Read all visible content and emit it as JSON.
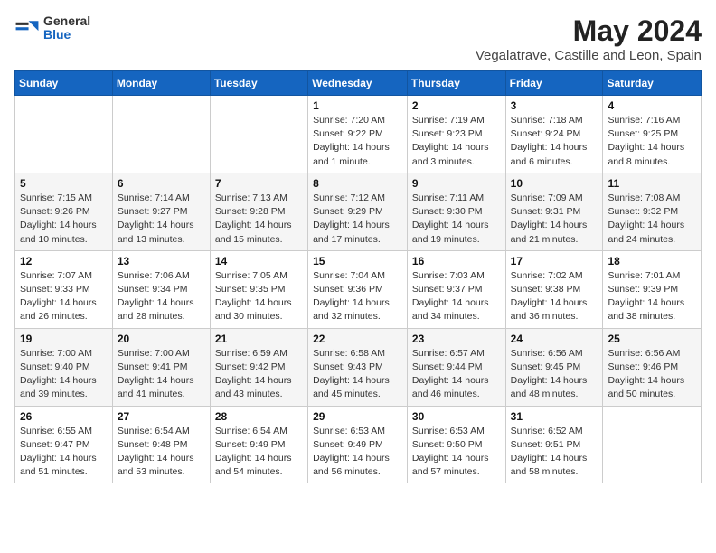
{
  "header": {
    "logo_general": "General",
    "logo_blue": "Blue",
    "month": "May 2024",
    "location": "Vegalatrave, Castille and Leon, Spain"
  },
  "weekdays": [
    "Sunday",
    "Monday",
    "Tuesday",
    "Wednesday",
    "Thursday",
    "Friday",
    "Saturday"
  ],
  "weeks": [
    [
      {
        "num": "",
        "info": ""
      },
      {
        "num": "",
        "info": ""
      },
      {
        "num": "",
        "info": ""
      },
      {
        "num": "1",
        "info": "Sunrise: 7:20 AM\nSunset: 9:22 PM\nDaylight: 14 hours\nand 1 minute."
      },
      {
        "num": "2",
        "info": "Sunrise: 7:19 AM\nSunset: 9:23 PM\nDaylight: 14 hours\nand 3 minutes."
      },
      {
        "num": "3",
        "info": "Sunrise: 7:18 AM\nSunset: 9:24 PM\nDaylight: 14 hours\nand 6 minutes."
      },
      {
        "num": "4",
        "info": "Sunrise: 7:16 AM\nSunset: 9:25 PM\nDaylight: 14 hours\nand 8 minutes."
      }
    ],
    [
      {
        "num": "5",
        "info": "Sunrise: 7:15 AM\nSunset: 9:26 PM\nDaylight: 14 hours\nand 10 minutes."
      },
      {
        "num": "6",
        "info": "Sunrise: 7:14 AM\nSunset: 9:27 PM\nDaylight: 14 hours\nand 13 minutes."
      },
      {
        "num": "7",
        "info": "Sunrise: 7:13 AM\nSunset: 9:28 PM\nDaylight: 14 hours\nand 15 minutes."
      },
      {
        "num": "8",
        "info": "Sunrise: 7:12 AM\nSunset: 9:29 PM\nDaylight: 14 hours\nand 17 minutes."
      },
      {
        "num": "9",
        "info": "Sunrise: 7:11 AM\nSunset: 9:30 PM\nDaylight: 14 hours\nand 19 minutes."
      },
      {
        "num": "10",
        "info": "Sunrise: 7:09 AM\nSunset: 9:31 PM\nDaylight: 14 hours\nand 21 minutes."
      },
      {
        "num": "11",
        "info": "Sunrise: 7:08 AM\nSunset: 9:32 PM\nDaylight: 14 hours\nand 24 minutes."
      }
    ],
    [
      {
        "num": "12",
        "info": "Sunrise: 7:07 AM\nSunset: 9:33 PM\nDaylight: 14 hours\nand 26 minutes."
      },
      {
        "num": "13",
        "info": "Sunrise: 7:06 AM\nSunset: 9:34 PM\nDaylight: 14 hours\nand 28 minutes."
      },
      {
        "num": "14",
        "info": "Sunrise: 7:05 AM\nSunset: 9:35 PM\nDaylight: 14 hours\nand 30 minutes."
      },
      {
        "num": "15",
        "info": "Sunrise: 7:04 AM\nSunset: 9:36 PM\nDaylight: 14 hours\nand 32 minutes."
      },
      {
        "num": "16",
        "info": "Sunrise: 7:03 AM\nSunset: 9:37 PM\nDaylight: 14 hours\nand 34 minutes."
      },
      {
        "num": "17",
        "info": "Sunrise: 7:02 AM\nSunset: 9:38 PM\nDaylight: 14 hours\nand 36 minutes."
      },
      {
        "num": "18",
        "info": "Sunrise: 7:01 AM\nSunset: 9:39 PM\nDaylight: 14 hours\nand 38 minutes."
      }
    ],
    [
      {
        "num": "19",
        "info": "Sunrise: 7:00 AM\nSunset: 9:40 PM\nDaylight: 14 hours\nand 39 minutes."
      },
      {
        "num": "20",
        "info": "Sunrise: 7:00 AM\nSunset: 9:41 PM\nDaylight: 14 hours\nand 41 minutes."
      },
      {
        "num": "21",
        "info": "Sunrise: 6:59 AM\nSunset: 9:42 PM\nDaylight: 14 hours\nand 43 minutes."
      },
      {
        "num": "22",
        "info": "Sunrise: 6:58 AM\nSunset: 9:43 PM\nDaylight: 14 hours\nand 45 minutes."
      },
      {
        "num": "23",
        "info": "Sunrise: 6:57 AM\nSunset: 9:44 PM\nDaylight: 14 hours\nand 46 minutes."
      },
      {
        "num": "24",
        "info": "Sunrise: 6:56 AM\nSunset: 9:45 PM\nDaylight: 14 hours\nand 48 minutes."
      },
      {
        "num": "25",
        "info": "Sunrise: 6:56 AM\nSunset: 9:46 PM\nDaylight: 14 hours\nand 50 minutes."
      }
    ],
    [
      {
        "num": "26",
        "info": "Sunrise: 6:55 AM\nSunset: 9:47 PM\nDaylight: 14 hours\nand 51 minutes."
      },
      {
        "num": "27",
        "info": "Sunrise: 6:54 AM\nSunset: 9:48 PM\nDaylight: 14 hours\nand 53 minutes."
      },
      {
        "num": "28",
        "info": "Sunrise: 6:54 AM\nSunset: 9:49 PM\nDaylight: 14 hours\nand 54 minutes."
      },
      {
        "num": "29",
        "info": "Sunrise: 6:53 AM\nSunset: 9:49 PM\nDaylight: 14 hours\nand 56 minutes."
      },
      {
        "num": "30",
        "info": "Sunrise: 6:53 AM\nSunset: 9:50 PM\nDaylight: 14 hours\nand 57 minutes."
      },
      {
        "num": "31",
        "info": "Sunrise: 6:52 AM\nSunset: 9:51 PM\nDaylight: 14 hours\nand 58 minutes."
      },
      {
        "num": "",
        "info": ""
      }
    ]
  ]
}
